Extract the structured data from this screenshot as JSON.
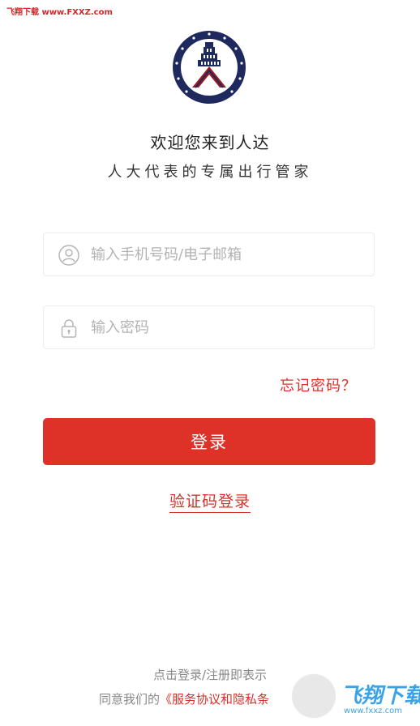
{
  "watermark": {
    "top_text": "飞翔下载 www.FXXZ.com",
    "bottom_title": "飞翔下载",
    "bottom_url": "www.fxxz.com"
  },
  "header": {
    "title": "欢迎您来到人达",
    "subtitle": "人大代表的专属出行管家"
  },
  "form": {
    "phone_placeholder": "输入手机号码/电子邮箱",
    "password_placeholder": "输入密码",
    "forgot_label": "忘记密码？",
    "login_label": "登录",
    "code_login_label": "验证码登录"
  },
  "footer": {
    "line1": "点击登录/注册即表示",
    "line2_prefix": "同意我们的",
    "terms_link": "《服务协议和隐私条"
  },
  "colors": {
    "accent": "#de3127",
    "logo_navy": "#1e2a5e",
    "logo_red": "#9b1b20"
  },
  "icons": [
    "logo-emblem",
    "user-icon",
    "lock-icon"
  ]
}
